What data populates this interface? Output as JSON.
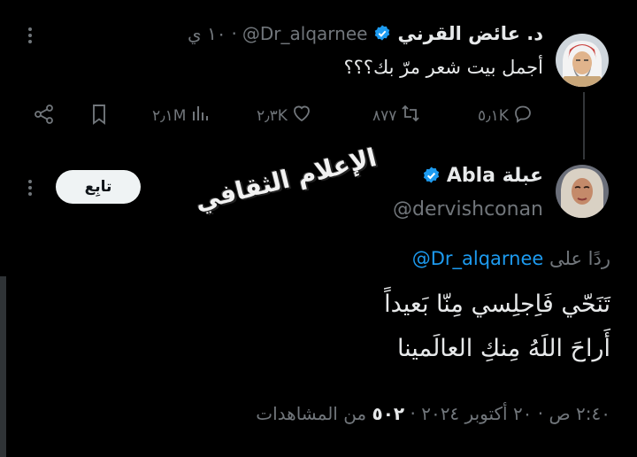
{
  "tweet_1": {
    "author_name": "د. عائض القرني",
    "handle": "@Dr_alqarnee",
    "time": "١٠ ي",
    "text": "أجمل بيت شعر مرّ بك؟؟؟",
    "actions": {
      "replies": "٥٫١K",
      "retweets": "٨٧٧",
      "likes": "٢٫٣K",
      "views": "٢٫١M"
    }
  },
  "tweet_2": {
    "author_name": "عبلة Abla",
    "handle": "@dervishconan",
    "follow_label": "تابِع",
    "reply_prefix": "ردًا على",
    "reply_to": "@Dr_alqarnee",
    "line_1": "تَنَحّي فَاِجلِسي مِنّا بَعيداً",
    "line_2": "أَراحَ اللَهُ مِنكِ العالَمينا",
    "meta_time": "٢:٤٠ ص · ٢٠ أكتوبر ٢٠٢٤ ·",
    "views_count": "٥٠٢",
    "views_label": "من المشاهدات"
  },
  "watermark": "الإعلام الثقافي",
  "colors": {
    "background": "#000000",
    "text": "#e7e9ea",
    "muted": "#71767b",
    "link": "#1d9bf0",
    "verified": "#1d9bf0"
  }
}
